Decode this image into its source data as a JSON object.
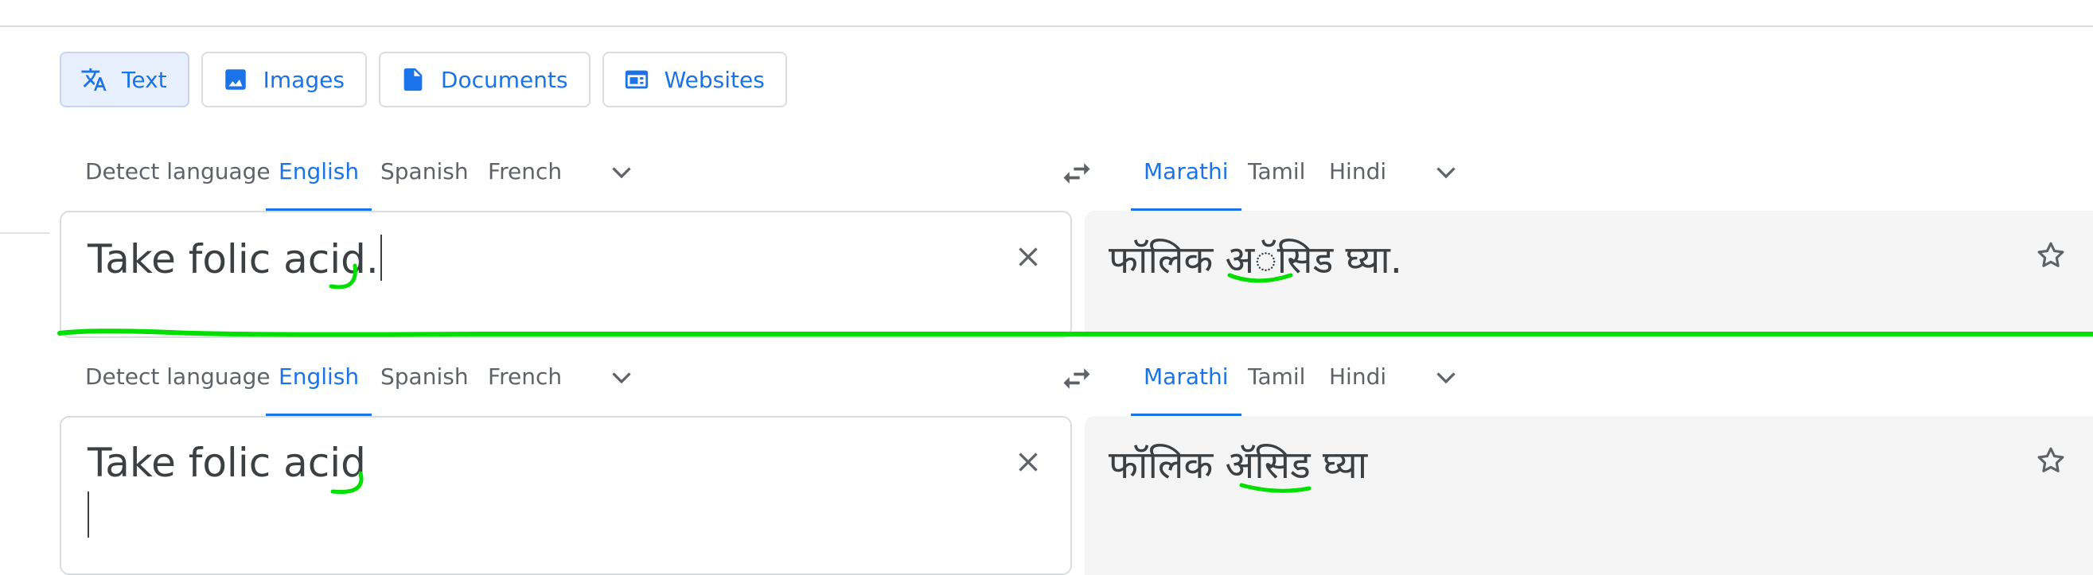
{
  "modes": [
    {
      "label": "Text",
      "icon": "translate-icon",
      "active": true
    },
    {
      "label": "Images",
      "icon": "image-icon"
    },
    {
      "label": "Documents",
      "icon": "document-icon"
    },
    {
      "label": "Websites",
      "icon": "website-icon"
    }
  ],
  "panels": [
    {
      "source_langs": [
        "Detect language",
        "English",
        "Spanish",
        "French"
      ],
      "source_active": "English",
      "target_langs": [
        "Marathi",
        "Tamil",
        "Hindi"
      ],
      "target_active": "Marathi",
      "source_text": "Take folic acid.",
      "target_text": "फॉलिक अॅसिड घ्या."
    },
    {
      "source_langs": [
        "Detect language",
        "English",
        "Spanish",
        "French"
      ],
      "source_active": "English",
      "target_langs": [
        "Marathi",
        "Tamil",
        "Hindi"
      ],
      "target_active": "Marathi",
      "source_text": "Take folic acid",
      "target_text": "फॉलिक ॲसिड घ्या"
    }
  ],
  "colors": {
    "accent": "#1a73e8",
    "annotation": "#00e000",
    "target_bg": "#f5f5f5"
  }
}
